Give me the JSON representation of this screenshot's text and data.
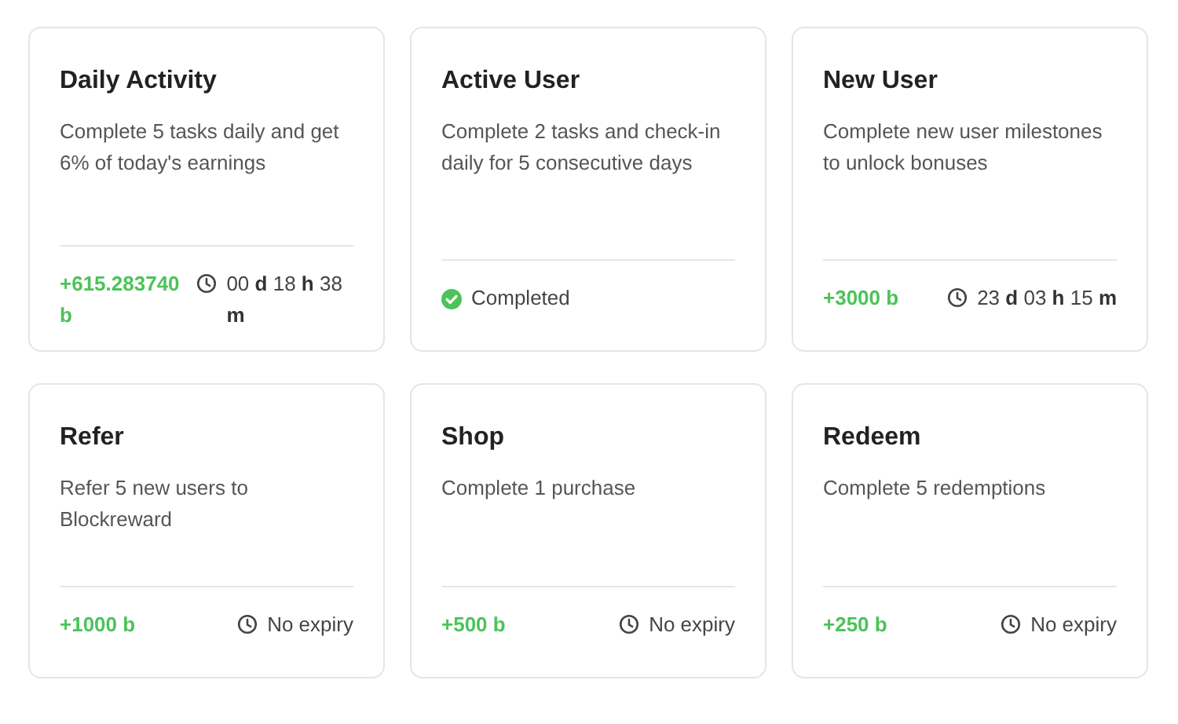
{
  "tasks": [
    {
      "title": "Daily Activity",
      "description": "Complete 5 tasks daily and get 6% of today's earnings",
      "kind": "reward",
      "reward": "+615.283740 b",
      "expiry": "00 **d** 18 **h** 38 **m**"
    },
    {
      "title": "Active User",
      "description": "Complete 2 tasks and check-in daily for 5 consecutive days",
      "kind": "completed",
      "status": "Completed"
    },
    {
      "title": "New User",
      "description": "Complete new user milestones to unlock bonuses",
      "kind": "reward",
      "reward": "+3000 b",
      "expiry": "23 **d** 03 **h** 15 **m**"
    },
    {
      "title": "Refer",
      "description": "Refer 5 new users to Blockreward",
      "kind": "reward",
      "reward": "+1000 b",
      "expiry": "No expiry"
    },
    {
      "title": "Shop",
      "description": "Complete 1 purchase",
      "kind": "reward",
      "reward": "+500 b",
      "expiry": "No expiry"
    },
    {
      "title": "Redeem",
      "description": "Complete 5 redemptions",
      "kind": "reward",
      "reward": "+250 b",
      "expiry": "No expiry"
    }
  ]
}
